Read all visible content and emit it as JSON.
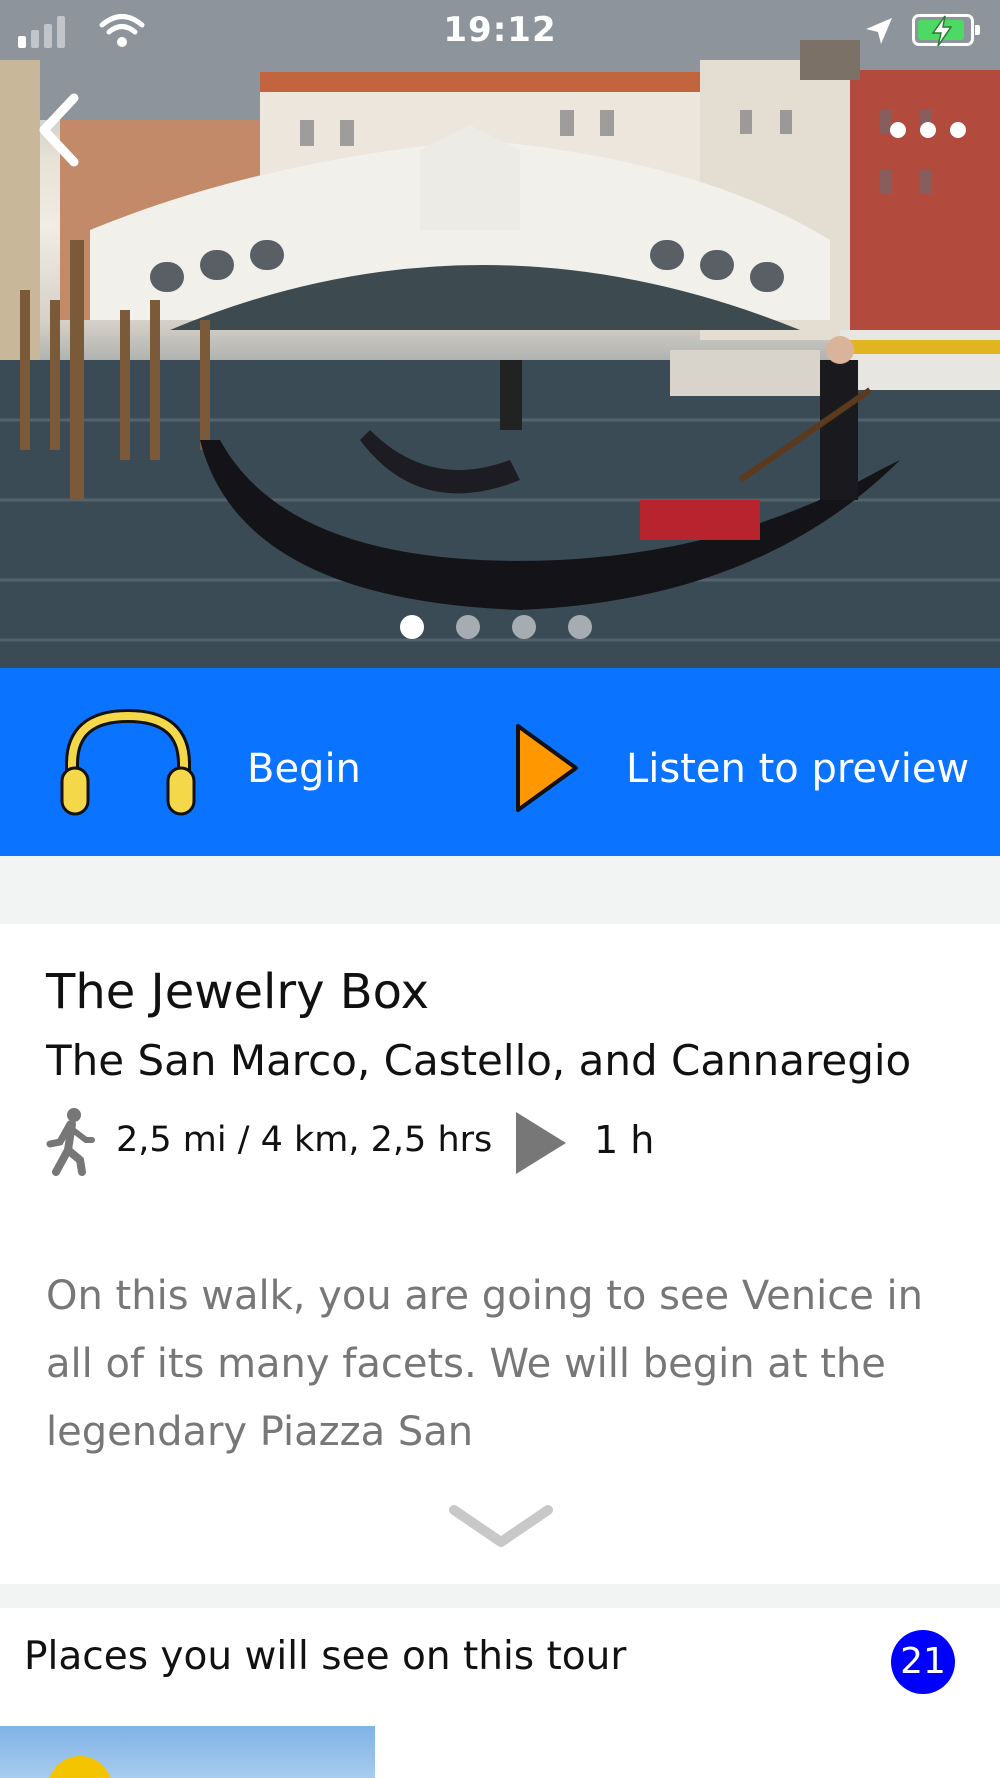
{
  "status_bar": {
    "time": "19:12",
    "signal_icon": "cellular-signal-icon",
    "wifi_icon": "wifi-icon",
    "location_icon": "location-arrow-icon",
    "battery_icon": "battery-charging-icon",
    "battery_level": 0.82
  },
  "hero": {
    "image_icon": "venice-rialto-bridge-gondola-photo",
    "back_icon": "chevron-left-icon",
    "more_icon": "more-dots-icon",
    "page_count": 4,
    "active_page": 1
  },
  "actions": {
    "begin_label": "Begin",
    "begin_icon": "headphones-icon",
    "preview_label": "Listen to preview",
    "preview_icon": "play-icon"
  },
  "tour": {
    "title": "The Jewelry Box",
    "subtitle": "The San Marco, Castello, and Cannaregio",
    "walk_icon": "walking-person-icon",
    "distance": "2,5 mi / 4 km, 2,5 hrs",
    "duration_icon": "play-icon",
    "duration": "1 h",
    "description": "On this walk, you are going to see Venice in all of its many facets. We will begin at the legendary Piazza San",
    "expand_icon": "chevron-down-icon"
  },
  "places": {
    "title": "Places you will see on this tour",
    "count": "21"
  },
  "colors": {
    "action_bar": "#0a73ff",
    "headphones": "#f5d84a",
    "play_orange": "#ff9800",
    "count_badge": "#0000ff",
    "description_text": "#777777"
  }
}
